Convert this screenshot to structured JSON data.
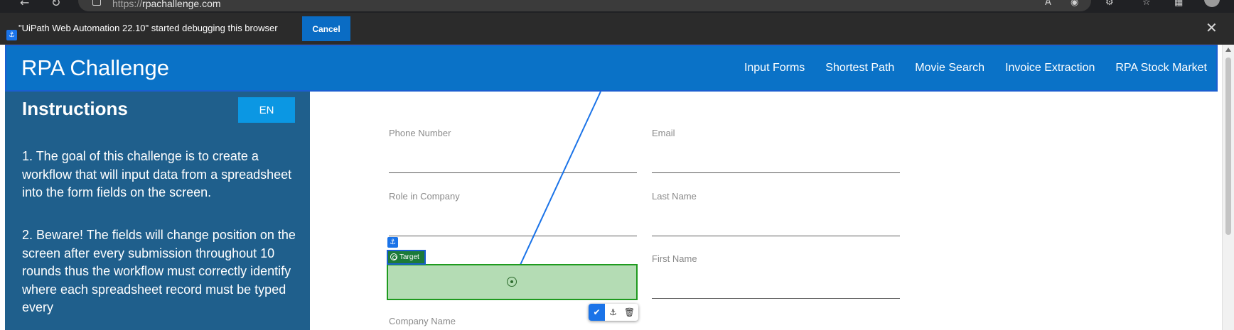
{
  "browser": {
    "url_prefix": "https://",
    "url_host": "rpachallenge.com",
    "icons": [
      "back-icon",
      "reload-icon",
      "site-info-icon",
      "read-aloud-icon",
      "tracking-prevention-icon",
      "extensions-icon",
      "favorites-icon",
      "collections-icon",
      "profile-icon"
    ]
  },
  "debug_bar": {
    "message": "\"UiPath Web Automation 22.10\" started debugging this browser",
    "cancel_label": "Cancel"
  },
  "site": {
    "logo": "RPA Challenge",
    "nav": [
      "Input Forms",
      "Shortest Path",
      "Movie Search",
      "Invoice Extraction",
      "RPA Stock Market"
    ]
  },
  "sidebar": {
    "title": "Instructions",
    "language": "EN",
    "instructions": [
      "1. The goal of this challenge is to create a workflow that will input data from a spreadsheet into the form fields on the screen.",
      "2. Beware! The fields will change position on the screen after every submission throughout 10 rounds thus the workflow must correctly identify where each spreadsheet record must be typed every"
    ]
  },
  "form": {
    "fields": [
      {
        "label": "Phone Number",
        "value": ""
      },
      {
        "label": "Email",
        "value": ""
      },
      {
        "label": "Role in Company",
        "value": ""
      },
      {
        "label": "Last Name",
        "value": ""
      },
      {
        "label": "First Name",
        "value": ""
      },
      {
        "label": "Company Name",
        "value": ""
      }
    ]
  },
  "selection": {
    "tag_label": "Target",
    "highlight_color": "#b4dcb4",
    "border_color": "#1e9a1e",
    "anchor_color": "#1a73e8"
  },
  "colors": {
    "header": "#0a72c7",
    "sidebar": "#1f5f8c",
    "lang_button": "#0b97e3",
    "cancel_button": "#0a6cc4"
  }
}
